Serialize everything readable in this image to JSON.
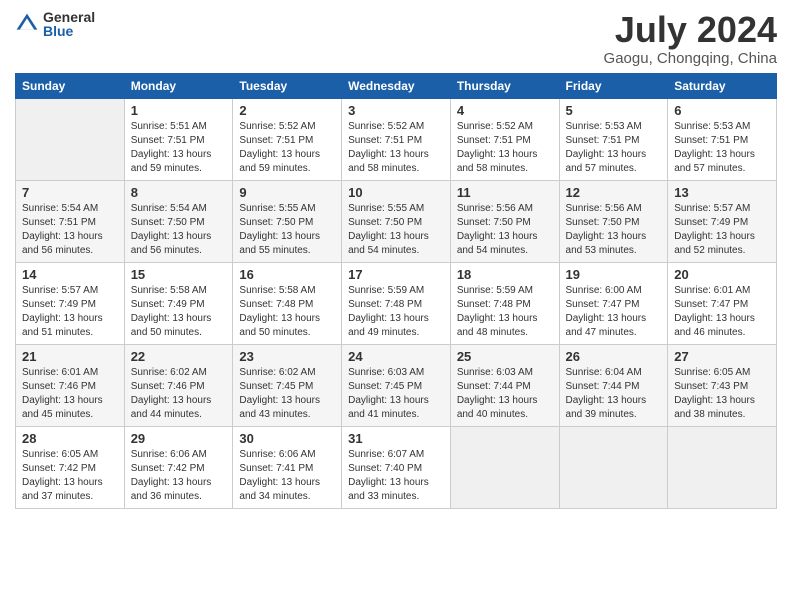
{
  "logo": {
    "general": "General",
    "blue": "Blue"
  },
  "header": {
    "title": "July 2024",
    "subtitle": "Gaogu, Chongqing, China"
  },
  "columns": [
    "Sunday",
    "Monday",
    "Tuesday",
    "Wednesday",
    "Thursday",
    "Friday",
    "Saturday"
  ],
  "weeks": [
    [
      {
        "day": "",
        "info": ""
      },
      {
        "day": "1",
        "info": "Sunrise: 5:51 AM\nSunset: 7:51 PM\nDaylight: 13 hours\nand 59 minutes."
      },
      {
        "day": "2",
        "info": "Sunrise: 5:52 AM\nSunset: 7:51 PM\nDaylight: 13 hours\nand 59 minutes."
      },
      {
        "day": "3",
        "info": "Sunrise: 5:52 AM\nSunset: 7:51 PM\nDaylight: 13 hours\nand 58 minutes."
      },
      {
        "day": "4",
        "info": "Sunrise: 5:52 AM\nSunset: 7:51 PM\nDaylight: 13 hours\nand 58 minutes."
      },
      {
        "day": "5",
        "info": "Sunrise: 5:53 AM\nSunset: 7:51 PM\nDaylight: 13 hours\nand 57 minutes."
      },
      {
        "day": "6",
        "info": "Sunrise: 5:53 AM\nSunset: 7:51 PM\nDaylight: 13 hours\nand 57 minutes."
      }
    ],
    [
      {
        "day": "7",
        "info": "Sunrise: 5:54 AM\nSunset: 7:51 PM\nDaylight: 13 hours\nand 56 minutes."
      },
      {
        "day": "8",
        "info": "Sunrise: 5:54 AM\nSunset: 7:50 PM\nDaylight: 13 hours\nand 56 minutes."
      },
      {
        "day": "9",
        "info": "Sunrise: 5:55 AM\nSunset: 7:50 PM\nDaylight: 13 hours\nand 55 minutes."
      },
      {
        "day": "10",
        "info": "Sunrise: 5:55 AM\nSunset: 7:50 PM\nDaylight: 13 hours\nand 54 minutes."
      },
      {
        "day": "11",
        "info": "Sunrise: 5:56 AM\nSunset: 7:50 PM\nDaylight: 13 hours\nand 54 minutes."
      },
      {
        "day": "12",
        "info": "Sunrise: 5:56 AM\nSunset: 7:50 PM\nDaylight: 13 hours\nand 53 minutes."
      },
      {
        "day": "13",
        "info": "Sunrise: 5:57 AM\nSunset: 7:49 PM\nDaylight: 13 hours\nand 52 minutes."
      }
    ],
    [
      {
        "day": "14",
        "info": "Sunrise: 5:57 AM\nSunset: 7:49 PM\nDaylight: 13 hours\nand 51 minutes."
      },
      {
        "day": "15",
        "info": "Sunrise: 5:58 AM\nSunset: 7:49 PM\nDaylight: 13 hours\nand 50 minutes."
      },
      {
        "day": "16",
        "info": "Sunrise: 5:58 AM\nSunset: 7:48 PM\nDaylight: 13 hours\nand 50 minutes."
      },
      {
        "day": "17",
        "info": "Sunrise: 5:59 AM\nSunset: 7:48 PM\nDaylight: 13 hours\nand 49 minutes."
      },
      {
        "day": "18",
        "info": "Sunrise: 5:59 AM\nSunset: 7:48 PM\nDaylight: 13 hours\nand 48 minutes."
      },
      {
        "day": "19",
        "info": "Sunrise: 6:00 AM\nSunset: 7:47 PM\nDaylight: 13 hours\nand 47 minutes."
      },
      {
        "day": "20",
        "info": "Sunrise: 6:01 AM\nSunset: 7:47 PM\nDaylight: 13 hours\nand 46 minutes."
      }
    ],
    [
      {
        "day": "21",
        "info": "Sunrise: 6:01 AM\nSunset: 7:46 PM\nDaylight: 13 hours\nand 45 minutes."
      },
      {
        "day": "22",
        "info": "Sunrise: 6:02 AM\nSunset: 7:46 PM\nDaylight: 13 hours\nand 44 minutes."
      },
      {
        "day": "23",
        "info": "Sunrise: 6:02 AM\nSunset: 7:45 PM\nDaylight: 13 hours\nand 43 minutes."
      },
      {
        "day": "24",
        "info": "Sunrise: 6:03 AM\nSunset: 7:45 PM\nDaylight: 13 hours\nand 41 minutes."
      },
      {
        "day": "25",
        "info": "Sunrise: 6:03 AM\nSunset: 7:44 PM\nDaylight: 13 hours\nand 40 minutes."
      },
      {
        "day": "26",
        "info": "Sunrise: 6:04 AM\nSunset: 7:44 PM\nDaylight: 13 hours\nand 39 minutes."
      },
      {
        "day": "27",
        "info": "Sunrise: 6:05 AM\nSunset: 7:43 PM\nDaylight: 13 hours\nand 38 minutes."
      }
    ],
    [
      {
        "day": "28",
        "info": "Sunrise: 6:05 AM\nSunset: 7:42 PM\nDaylight: 13 hours\nand 37 minutes."
      },
      {
        "day": "29",
        "info": "Sunrise: 6:06 AM\nSunset: 7:42 PM\nDaylight: 13 hours\nand 36 minutes."
      },
      {
        "day": "30",
        "info": "Sunrise: 6:06 AM\nSunset: 7:41 PM\nDaylight: 13 hours\nand 34 minutes."
      },
      {
        "day": "31",
        "info": "Sunrise: 6:07 AM\nSunset: 7:40 PM\nDaylight: 13 hours\nand 33 minutes."
      },
      {
        "day": "",
        "info": ""
      },
      {
        "day": "",
        "info": ""
      },
      {
        "day": "",
        "info": ""
      }
    ]
  ]
}
